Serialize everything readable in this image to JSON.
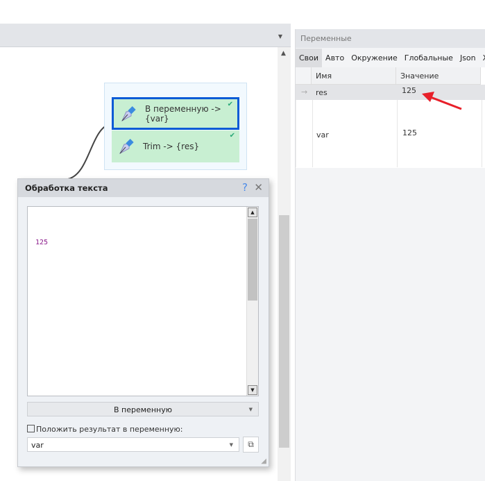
{
  "canvas": {
    "nodes": [
      {
        "line1": "В переменную ->",
        "line2": "{var}"
      },
      {
        "line1": "Trim -> {res}"
      }
    ]
  },
  "variables_panel": {
    "title": "Переменные",
    "tabs": [
      "Свои",
      "Авто",
      "Окружение",
      "Глобальные",
      "Json",
      "Xml"
    ],
    "columns": [
      "Имя",
      "Значение"
    ],
    "rows": [
      {
        "name": "res",
        "value": "125"
      },
      {
        "name": "var",
        "value": "125"
      }
    ],
    "annotation_color": "#e8202a"
  },
  "dialog": {
    "title": "Обработка текста",
    "help": "?",
    "close": "✕",
    "text": "125",
    "mode": "В переменную",
    "result_label": "Положить результат в переменную:",
    "result_var": "var"
  }
}
